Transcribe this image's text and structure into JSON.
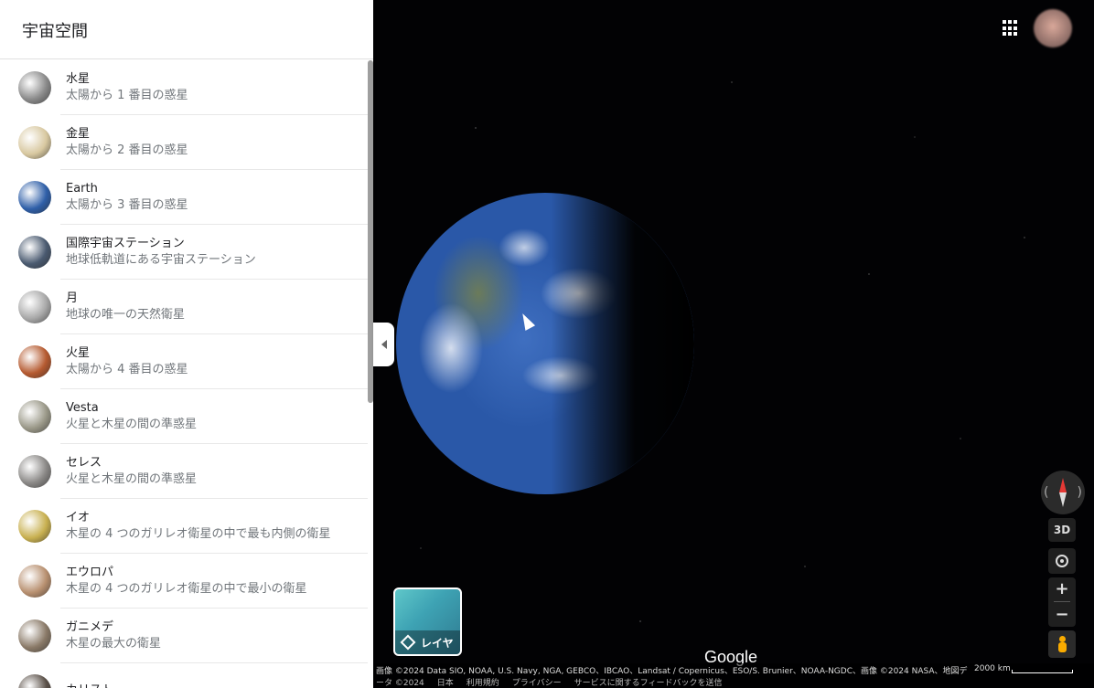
{
  "panel": {
    "title": "宇宙空間",
    "items": [
      {
        "name": "水星",
        "desc": "太陽から 1 番目の惑星",
        "color": "#8a8a8a"
      },
      {
        "name": "金星",
        "desc": "太陽から 2 番目の惑星",
        "color": "#d8c8a0"
      },
      {
        "name": "Earth",
        "desc": "太陽から 3 番目の惑星",
        "color": "#2f5fa8"
      },
      {
        "name": "国際宇宙ステーション",
        "desc": "地球低軌道にある宇宙ステーション",
        "color": "#4a5a70"
      },
      {
        "name": "月",
        "desc": "地球の唯一の天然衛星",
        "color": "#a8a8a8"
      },
      {
        "name": "火星",
        "desc": "太陽から 4 番目の惑星",
        "color": "#b55a30"
      },
      {
        "name": "Vesta",
        "desc": "火星と木星の間の準惑星",
        "color": "#9a9888"
      },
      {
        "name": "セレス",
        "desc": "火星と木星の間の準惑星",
        "color": "#8a8886"
      },
      {
        "name": "イオ",
        "desc": "木星の 4 つのガリレオ衛星の中で最も内側の衛星",
        "color": "#c8b050"
      },
      {
        "name": "エウロパ",
        "desc": "木星の 4 つのガリレオ衛星の中で最小の衛星",
        "color": "#b89070"
      },
      {
        "name": "ガニメデ",
        "desc": "木星の最大の衛星",
        "color": "#8a7a68"
      },
      {
        "name": "カリスト",
        "desc": "",
        "color": "#5a5048"
      }
    ]
  },
  "controls": {
    "three_d": "3D",
    "zoom_in": "+",
    "zoom_out": "−",
    "layers_label": "レイヤ"
  },
  "footer": {
    "logo": "Google",
    "attribution": "画像 ©2024 Data SIO, NOAA, U.S. Navy, NGA, GEBCO、IBCAO、Landsat / Copernicus、ESO/S. Brunier、NOAA-NGDC、画像 ©2024 NASA、地図デ",
    "scale": "2000 km",
    "links": [
      "ータ ©2024",
      "日本",
      "利用規約",
      "プライバシー",
      "サービスに関するフィードバックを送信"
    ]
  }
}
